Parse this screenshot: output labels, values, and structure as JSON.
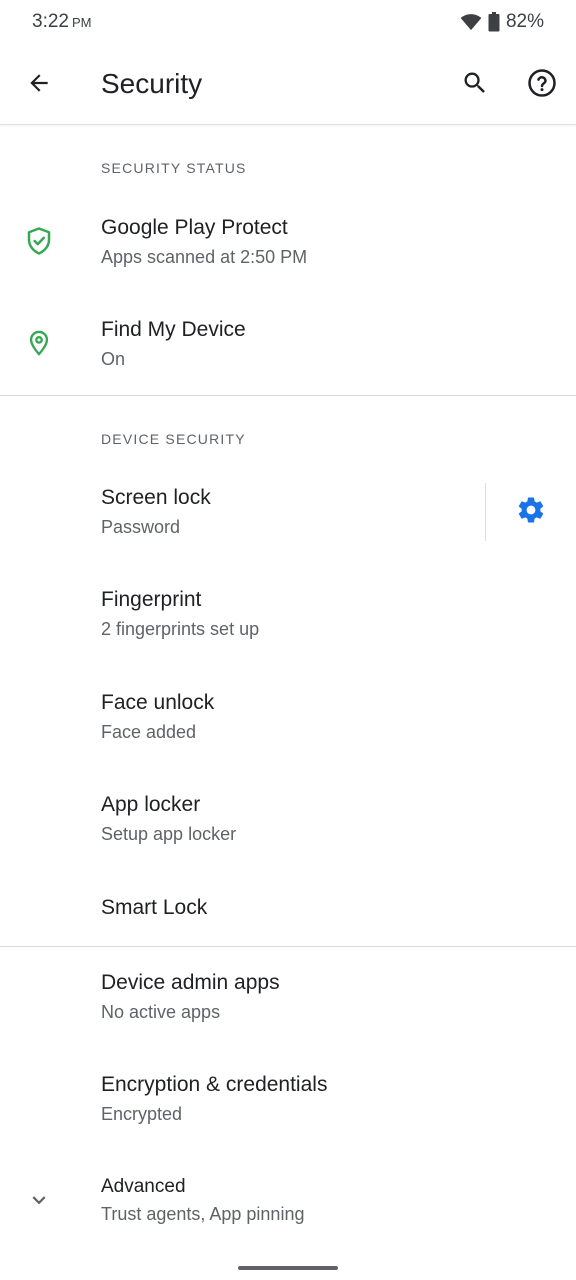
{
  "status_bar": {
    "time": "3:22",
    "ampm": "PM",
    "battery": "82%"
  },
  "app_bar": {
    "title": "Security"
  },
  "sections": {
    "security_status": "SECURITY STATUS",
    "device_security": "DEVICE SECURITY"
  },
  "items": {
    "play_protect": {
      "title": "Google Play Protect",
      "subtitle": "Apps scanned at 2:50 PM"
    },
    "find_my_device": {
      "title": "Find My Device",
      "subtitle": "On"
    },
    "screen_lock": {
      "title": "Screen lock",
      "subtitle": "Password"
    },
    "fingerprint": {
      "title": "Fingerprint",
      "subtitle": "2 fingerprints set up"
    },
    "face_unlock": {
      "title": "Face unlock",
      "subtitle": "Face added"
    },
    "app_locker": {
      "title": "App locker",
      "subtitle": "Setup app locker"
    },
    "smart_lock": {
      "title": "Smart Lock"
    },
    "device_admin": {
      "title": "Device admin apps",
      "subtitle": "No active apps"
    },
    "encryption": {
      "title": "Encryption & credentials",
      "subtitle": "Encrypted"
    },
    "advanced": {
      "title": "Advanced",
      "subtitle": "Trust agents, App pinning"
    }
  },
  "icons": {
    "back": "arrow-back-icon",
    "search": "search-icon",
    "help": "help-icon",
    "play_protect": "shield-check-icon",
    "find_my_device": "location-pin-icon",
    "screen_lock_settings": "gear-icon",
    "advanced": "chevron-down-icon"
  },
  "colors": {
    "accent_blue": "#1a73e8",
    "status_green": "#34a853",
    "text_primary": "#202124",
    "text_secondary": "#5f6368"
  }
}
